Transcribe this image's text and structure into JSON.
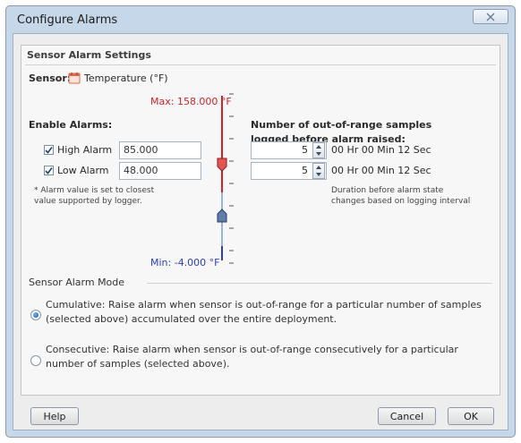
{
  "window": {
    "title": "Configure Alarms"
  },
  "section_title": "Sensor Alarm Settings",
  "sensor": {
    "label": "Sensor:",
    "name": "Temperature (°F)"
  },
  "limits": {
    "max": "Max: 158.000 °F",
    "min": "Min: -4.000 °F"
  },
  "enable_alarms": {
    "heading": "Enable Alarms:",
    "high": {
      "label": "High Alarm",
      "value": "85.000",
      "checked": true
    },
    "low": {
      "label": "Low Alarm",
      "value": "48.000",
      "checked": true
    },
    "note": "* Alarm value is set to closest\nvalue supported by logger."
  },
  "samples": {
    "heading_line1": "Number of out-of-range samples",
    "heading_line2": "logged before alarm raised:",
    "high_count": "5",
    "high_duration": "00 Hr 00 Min 12 Sec",
    "low_count": "5",
    "low_duration": "00 Hr 00 Min 12 Sec",
    "note": "Duration before alarm state\nchanges based on logging interval"
  },
  "mode": {
    "title": "Sensor Alarm Mode",
    "selected": "cumulative",
    "cumulative": "Cumulative: Raise alarm when sensor is out-of-range for a particular number of samples (selected above) accumulated over the entire deployment.",
    "consecutive": "Consecutive: Raise alarm when sensor is out-of-range consecutively for a particular number of samples (selected above)."
  },
  "buttons": {
    "help": "Help",
    "cancel": "Cancel",
    "ok": "OK"
  },
  "colors": {
    "high": "#d4242a",
    "low": "#2a3fbf",
    "sensor_icon": "#e06a4a"
  }
}
